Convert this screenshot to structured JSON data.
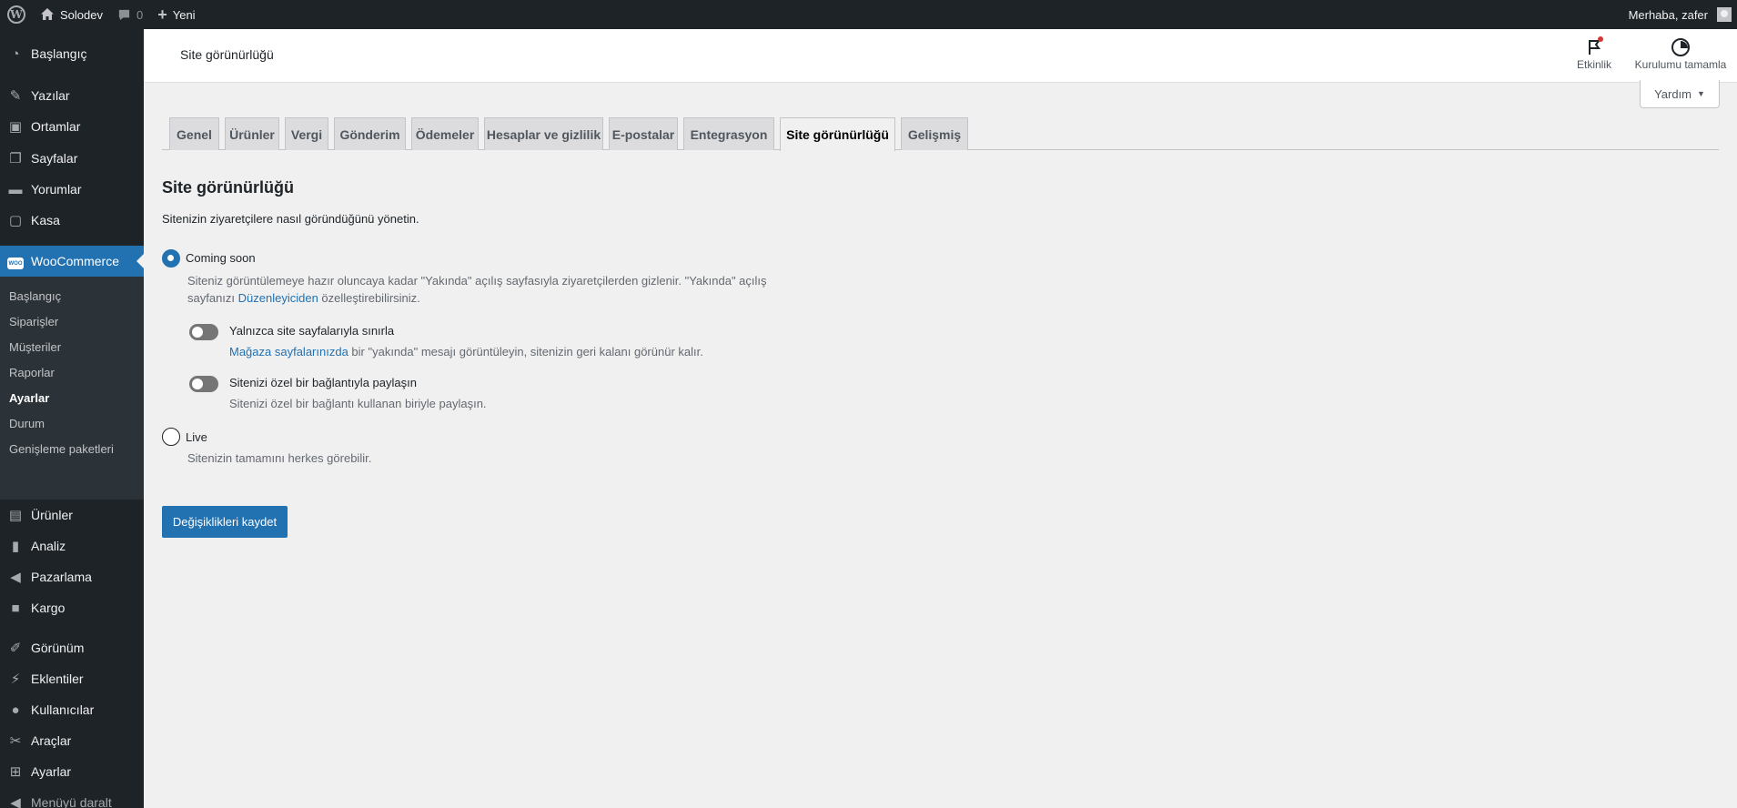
{
  "adminbar": {
    "site_name": "Solodev",
    "comments_count": "0",
    "new_label": "Yeni",
    "greeting": "Merhaba, zafer"
  },
  "sidebar": {
    "top_items": [
      {
        "label": "Başlangıç",
        "icon": "dashboard-icon"
      },
      {
        "label": "Yazılar",
        "icon": "pin-icon"
      },
      {
        "label": "Ortamlar",
        "icon": "media-icon"
      },
      {
        "label": "Sayfalar",
        "icon": "pages-icon"
      },
      {
        "label": "Yorumlar",
        "icon": "comments-icon"
      },
      {
        "label": "Kasa",
        "icon": "vault-icon"
      }
    ],
    "woocommerce": {
      "label": "WooCommerce",
      "badge": "WOO"
    },
    "sub_items": [
      {
        "label": "Başlangıç"
      },
      {
        "label": "Siparişler"
      },
      {
        "label": "Müşteriler"
      },
      {
        "label": "Raporlar"
      },
      {
        "label": "Ayarlar"
      },
      {
        "label": "Durum"
      },
      {
        "label": "Genişleme paketleri"
      }
    ],
    "bottom_items": [
      {
        "label": "Ürünler",
        "icon": "archive-icon"
      },
      {
        "label": "Analiz",
        "icon": "chart-icon"
      },
      {
        "label": "Pazarlama",
        "icon": "megaphone-icon"
      },
      {
        "label": "Kargo",
        "icon": "truck-icon"
      },
      {
        "label": "Görünüm",
        "icon": "brush-icon"
      },
      {
        "label": "Eklentiler",
        "icon": "plugin-icon"
      },
      {
        "label": "Kullanıcılar",
        "icon": "users-icon"
      },
      {
        "label": "Araçlar",
        "icon": "wrench-icon"
      },
      {
        "label": "Ayarlar",
        "icon": "settings-icon"
      }
    ],
    "collapse_label": "Menüyü daralt"
  },
  "header": {
    "title": "Site görünürlüğü",
    "activity_label": "Etkinlik",
    "setup_label": "Kurulumu tamamla"
  },
  "help": {
    "label": "Yardım"
  },
  "tabs": [
    {
      "label": "Genel"
    },
    {
      "label": "Ürünler"
    },
    {
      "label": "Vergi"
    },
    {
      "label": "Gönderim"
    },
    {
      "label": "Ödemeler"
    },
    {
      "label": "Hesaplar ve gizlilik"
    },
    {
      "label": "E-postalar"
    },
    {
      "label": "Entegrasyon"
    },
    {
      "label": "Site görünürlüğü"
    },
    {
      "label": "Gelişmiş"
    }
  ],
  "main": {
    "title": "Site görünürlüğü",
    "description": "Sitenizin ziyaretçilere nasıl göründüğünü yönetin.",
    "coming_soon": {
      "label": "Coming soon",
      "desc_line1": "Siteniz görüntülemeye hazır oluncaya kadar \"Yakında\" açılış sayfasıyla ziyaretçilerden gizlenir. \"Yakında\" açılış",
      "desc_line2_pre": "sayfanızı ",
      "desc_link": "Düzenleyiciden",
      "desc_line2_post": " özelleştirebilirsiniz.",
      "store_only": {
        "label": "Yalnızca site sayfalarıyla sınırla",
        "desc_link": "Mağaza sayfalarınızda",
        "desc_post": " bir \"yakında\" mesajı görüntüleyin, sitenizin geri kalanı görünür kalır."
      },
      "share": {
        "label": "Sitenizi özel bir bağlantıyla paylaşın",
        "desc": "Sitenizi özel bir bağlantı kullanan biriyle paylaşın."
      }
    },
    "live": {
      "label": "Live",
      "desc": "Sitenizin tamamını herkes görebilir."
    },
    "save_label": "Değişiklikleri kaydet"
  }
}
